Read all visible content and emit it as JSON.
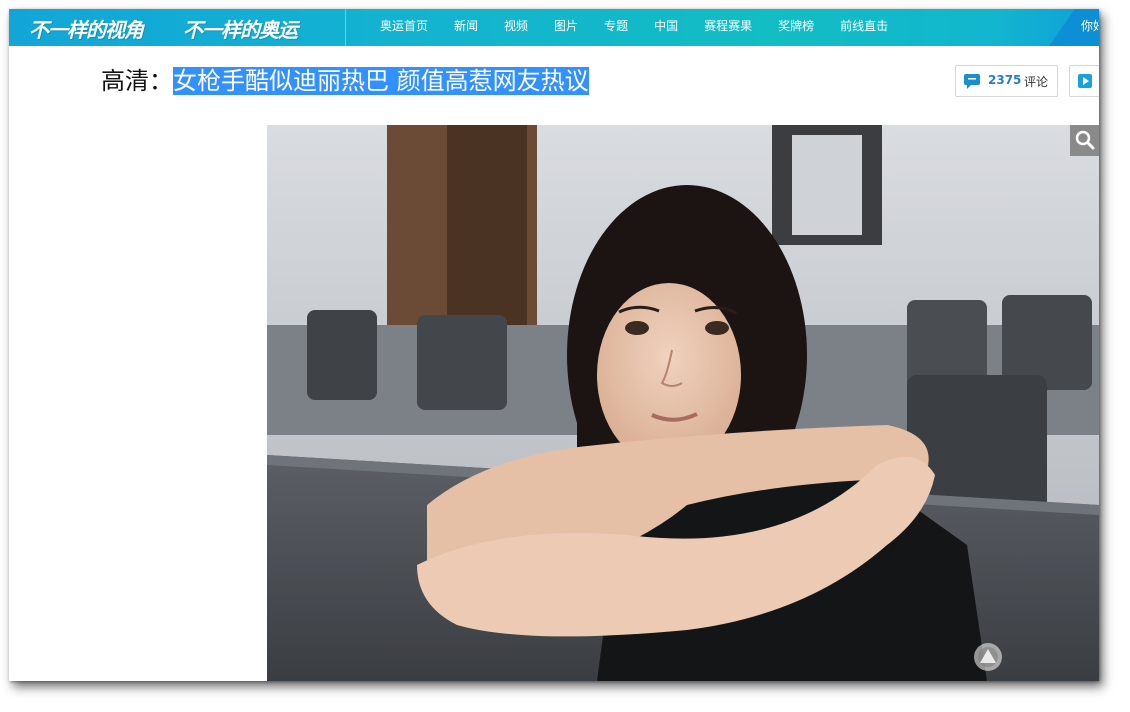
{
  "header": {
    "brand": [
      "不一样的视角",
      "不一样的奥运"
    ],
    "nav": [
      "奥运首页",
      "新闻",
      "视频",
      "图片",
      "专题",
      "中国",
      "赛程赛果",
      "奖牌榜",
      "前线直击"
    ],
    "user_greeting": "你好"
  },
  "article": {
    "title_prefix": "高清：",
    "title_main": "女枪手酷似迪丽热巴 颜值高惹网友热议"
  },
  "comments": {
    "count": "2375",
    "label": "评论"
  },
  "icons": {
    "comment": "speech-bubble-icon",
    "play": "play-icon",
    "zoom": "search-icon",
    "watermark": "site-logo-watermark"
  },
  "colors": {
    "topbar_start": "#12a6d8",
    "topbar_mid": "#12bdc3",
    "selection": "#3390ff",
    "count": "#2e7cc7"
  }
}
